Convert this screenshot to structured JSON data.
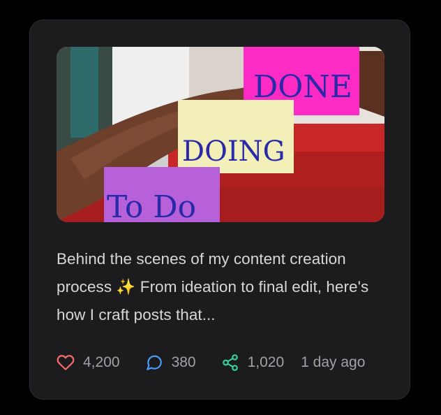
{
  "post": {
    "image": {
      "description_labels": [
        "To Do",
        "Doing",
        "Done"
      ]
    },
    "caption": "Behind the scenes of my content creation process ✨ From ideation to final edit, here's how I craft posts that...",
    "stats": {
      "likes": "4,200",
      "comments": "380",
      "shares": "1,020",
      "time": "1 day ago"
    },
    "icons": {
      "like": "heart-icon",
      "comment": "comment-bubble-icon",
      "share": "share-icon"
    },
    "colors": {
      "like": "#ff6b6b",
      "comment": "#4a9cff",
      "share": "#34d399"
    }
  }
}
